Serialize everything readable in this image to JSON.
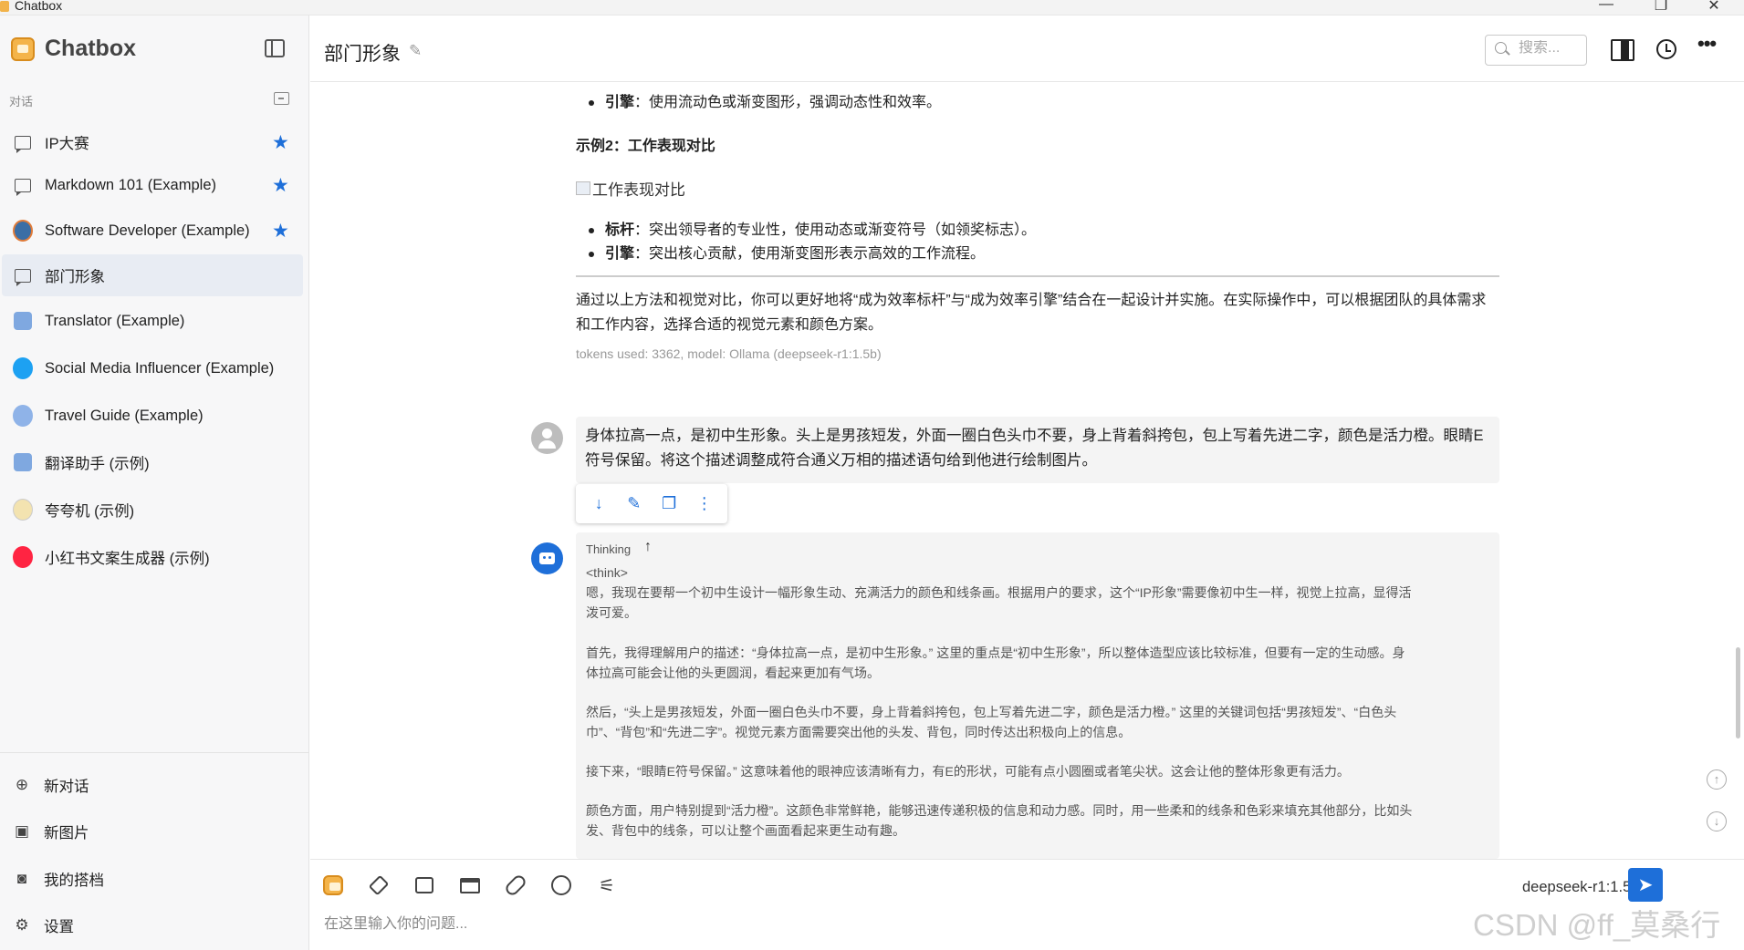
{
  "window": {
    "title": "Chatbox",
    "minimize": "—",
    "maximize": "❐",
    "close": "✕"
  },
  "sidebar": {
    "brand": "Chatbox",
    "section_label": "对话",
    "conversations": [
      {
        "label": "IP大赛",
        "starred": true,
        "icon": "chat-bubble-icon"
      },
      {
        "label": "Markdown 101 (Example)",
        "starred": true,
        "icon": "chat-bubble-icon"
      },
      {
        "label": "Software Developer (Example)",
        "starred": true,
        "icon": "developer-avatar"
      },
      {
        "label": "部门形象",
        "starred": false,
        "icon": "chat-bubble-icon",
        "active": true
      },
      {
        "label": "Translator (Example)",
        "starred": false,
        "icon": "translator-avatar"
      },
      {
        "label": "Social Media Influencer (Example)",
        "starred": false,
        "icon": "twitter-avatar"
      },
      {
        "label": "Travel Guide (Example)",
        "starred": false,
        "icon": "globe-avatar"
      },
      {
        "label": "翻译助手 (示例)",
        "starred": false,
        "icon": "translator-avatar"
      },
      {
        "label": "夸夸机 (示例)",
        "starred": false,
        "icon": "cheer-avatar"
      },
      {
        "label": "小红书文案生成器 (示例)",
        "starred": false,
        "icon": "xiaohongshu-avatar"
      }
    ],
    "bottom": {
      "new_chat": "新对话",
      "new_image": "新图片",
      "my_partners": "我的搭档",
      "settings": "设置"
    }
  },
  "header": {
    "title": "部门形象",
    "search_placeholder": "搜索..."
  },
  "thread": {
    "bullet_top": {
      "bold": "引擎",
      "text": "：使用流动色或渐变图形，强调动态性和效率。"
    },
    "example_heading": "示例2：工作表现对比",
    "broken_image_alt": "工作表现对比",
    "bullets": [
      {
        "bold": "标杆",
        "text": "：突出领导者的专业性，使用动态或渐变符号（如领奖标志）。"
      },
      {
        "bold": "引擎",
        "text": "：突出核心贡献，使用渐变图形表示高效的工作流程。"
      }
    ],
    "paragraph": "通过以上方法和视觉对比，你可以更好地将“成为效率标杆”与“成为效率引擎”结合在一起设计并实施。在实际操作中，可以根据团队的具体需求和工作内容，选择合适的视觉元素和颜色方案。",
    "token_info": "tokens used: 3362, model: Ollama (deepseek-r1:1.5b)",
    "user_message": "身体拉高一点，是初中生形象。头上是男孩短发，外面一圈白色头巾不要，身上背着斜挎包，包上写着先进二字，颜色是活力橙。眼睛E符号保留。将这个描述调整成符合通义万相的描述语句给到他进行绘制图片。",
    "thinking_label": "Thinking",
    "think_lines": [
      "<think>",
      "嗯，我现在要帮一个初中生设计一幅形象生动、充满活力的颜色和线条画。根据用户的要求，这个“IP形象”需要像初中生一样，视觉上拉高，显得活",
      "泼可爱。",
      "",
      "首先，我得理解用户的描述：“身体拉高一点，是初中生形象。” 这里的重点是“初中生形象”，所以整体造型应该比较标准，但要有一定的生动感。身",
      "体拉高可能会让他的头更圆润，看起来更加有气场。",
      "",
      "然后，“头上是男孩短发，外面一圈白色头巾不要，身上背着斜挎包，包上写着先进二字，颜色是活力橙。” 这里的关键词包括“男孩短发”、“白色头",
      "巾”、“背包”和“先进二字”。视觉元素方面需要突出他的头发、背包，同时传达出积极向上的信息。",
      "",
      "接下来，“眼睛E符号保留。” 这意味着他的眼神应该清晰有力，有E的形状，可能有点小圆圈或者笔尖状。这会让他的整体形象更有活力。",
      "",
      "颜色方面，用户特别提到“活力橙”。这颜色非常鲜艳，能够迅速传递积极的信息和动力感。同时，用一些柔和的线条和色彩来填充其他部分，比如头",
      "发、背包中的线条，可以让整个画面看起来更生动有趣。"
    ]
  },
  "composer": {
    "placeholder": "在这里输入你的问题...",
    "model": "deepseek-r1:1.5b ⌃"
  },
  "watermark": "CSDN @ff_莫桑行",
  "colors": {
    "accent": "#1e6fd9",
    "sidebar_bg": "#f7f7f8",
    "active_bg": "#e8ecf3"
  }
}
